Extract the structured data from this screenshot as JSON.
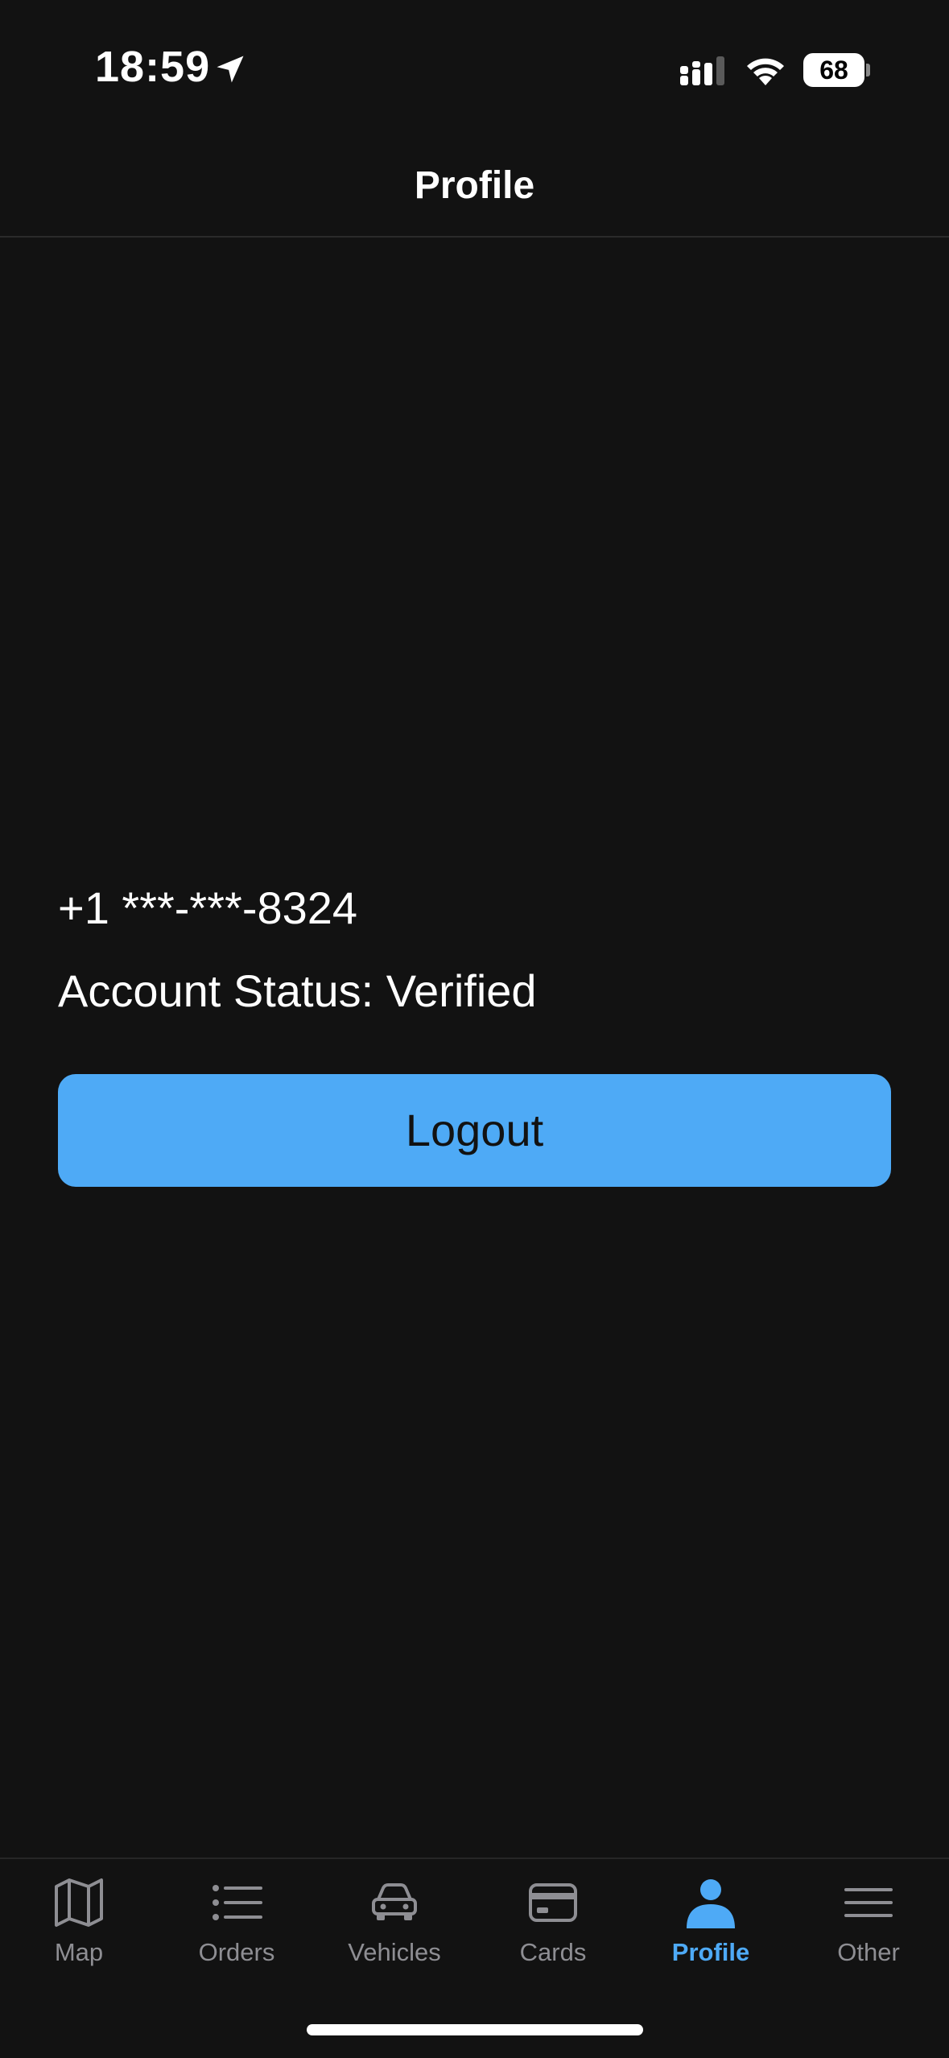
{
  "status_bar": {
    "time": "18:59",
    "battery_level": "68"
  },
  "header": {
    "title": "Profile"
  },
  "profile": {
    "phone": "+1 ***-***-8324",
    "account_status": "Account Status: Verified",
    "logout_label": "Logout"
  },
  "tabs": [
    {
      "label": "Map",
      "icon": "map-icon",
      "active": false
    },
    {
      "label": "Orders",
      "icon": "list-icon",
      "active": false
    },
    {
      "label": "Vehicles",
      "icon": "car-icon",
      "active": false
    },
    {
      "label": "Cards",
      "icon": "card-icon",
      "active": false
    },
    {
      "label": "Profile",
      "icon": "person-icon",
      "active": true
    },
    {
      "label": "Other",
      "icon": "menu-icon",
      "active": false
    }
  ],
  "colors": {
    "background": "#121212",
    "accent": "#4eaaf6",
    "inactive_tab": "#8e8e93"
  }
}
